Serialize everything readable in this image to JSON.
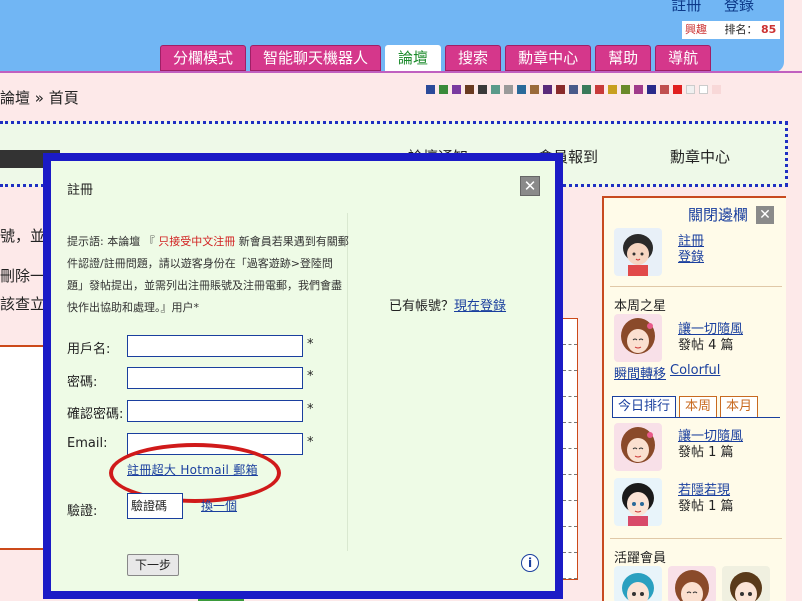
{
  "header": {
    "auth": [
      "註冊",
      "登錄"
    ],
    "hobby_label": "興趣",
    "rank_label": "排名：",
    "rank_value": "85",
    "nav": [
      "分欄模式",
      "智能聊天機器人",
      "論壇",
      "搜索",
      "勳章中心",
      "幫助",
      "導航"
    ],
    "active_nav": "論壇",
    "swatch_colors": [
      "#2b4a9a",
      "#3a8a3a",
      "#7a3aa0",
      "#6a3a20",
      "#3a3a3a",
      "#5a9a8a",
      "#9a9a9a",
      "#2a6a9a",
      "#9a6a3a",
      "#5a2a7a",
      "#8a2a2a",
      "#4a5a8a",
      "#3a7a5a",
      "#c83a3a",
      "#c8a020",
      "#6a8a2a",
      "#a03a8a",
      "#2a2a8a",
      "#c05050",
      "#e02020",
      "#f0f0f0",
      "#ffffff",
      "#f8d8d8"
    ]
  },
  "breadcrumb": "論壇 » 首頁",
  "strip": {
    "items": [
      "論壇通知",
      "會員報到",
      "勳章中心"
    ]
  },
  "left_underlying": {
    "line1": "號，並以",
    "line2": "刪除一",
    "line3": "該查立"
  },
  "sidebar": {
    "close_label": "關閉邊欄",
    "user_links": [
      "註冊",
      "登錄"
    ],
    "star_section": "本周之星",
    "star_user": "讓一切隨風",
    "star_posts": "發帖 4 篇",
    "star_extra": [
      "瞬間轉移",
      "Colorful"
    ],
    "tabs": [
      "今日排行",
      "本周",
      "本月"
    ],
    "rank": [
      {
        "name": "讓一切隨風",
        "posts": "發帖 1 篇"
      },
      {
        "name": "若隱若現",
        "posts": "發帖 1 篇"
      }
    ],
    "active_section": "活躍會員"
  },
  "modal": {
    "title": "註冊",
    "notice_prefix": "提示語: 本論壇 『",
    "notice_red": " 只接受中文注冊",
    "notice_rest": " 新會員若果遇到有關郵件認證/註冊問題，請以遊客身份在「過客遊跡>登陸問題」發帖提出，並需列出注冊賬號及注冊電郵，我們會盡快作出協助和處理。』用户*",
    "labels": {
      "username": "用戶名:",
      "password": "密碼:",
      "confirm": "確認密碼:",
      "email": "Email:",
      "captcha": "驗證:"
    },
    "required_mark": "*",
    "hotmail_link": "註冊超大 Hotmail 郵箱",
    "captcha_placeholder": "驗證碼",
    "refresh_link": "換一個",
    "next_button": "下一步",
    "have_account": "已有帳號？",
    "login_now": "現在登錄",
    "info_icon": "i"
  }
}
